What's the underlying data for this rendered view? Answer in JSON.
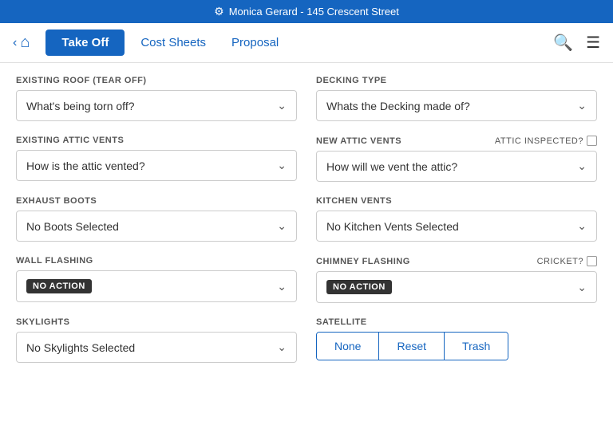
{
  "topBar": {
    "icon": "⚙",
    "text": "Monica Gerard - 145 Crescent Street"
  },
  "nav": {
    "takeoff_label": "Take Off",
    "cost_sheets_label": "Cost Sheets",
    "proposal_label": "Proposal"
  },
  "form": {
    "existing_roof_label": "EXISTING ROOF (TEAR OFF)",
    "existing_roof_placeholder": "What's being torn off?",
    "decking_type_label": "DECKING TYPE",
    "decking_type_placeholder": "Whats the Decking made of?",
    "existing_attic_label": "EXISTING ATTIC VENTS",
    "existing_attic_placeholder": "How is the attic vented?",
    "new_attic_label": "NEW ATTIC VENTS",
    "new_attic_placeholder": "How will we vent the attic?",
    "attic_inspected_label": "Attic Inspected?",
    "exhaust_boots_label": "EXHAUST BOOTS",
    "exhaust_boots_placeholder": "No Boots Selected",
    "kitchen_vents_label": "KITCHEN VENTS",
    "kitchen_vents_placeholder": "No Kitchen Vents Selected",
    "wall_flashing_label": "WALL FLASHING",
    "wall_flashing_value": "NO ACTION",
    "chimney_flashing_label": "CHIMNEY FLASHING",
    "chimney_flashing_value": "NO ACTION",
    "cricket_label": "Cricket?",
    "skylights_label": "SKYLIGHTS",
    "skylights_placeholder": "No Skylights Selected",
    "satellite_label": "SATELLITE",
    "satellite_none": "None",
    "satellite_reset": "Reset",
    "satellite_trash": "Trash"
  }
}
